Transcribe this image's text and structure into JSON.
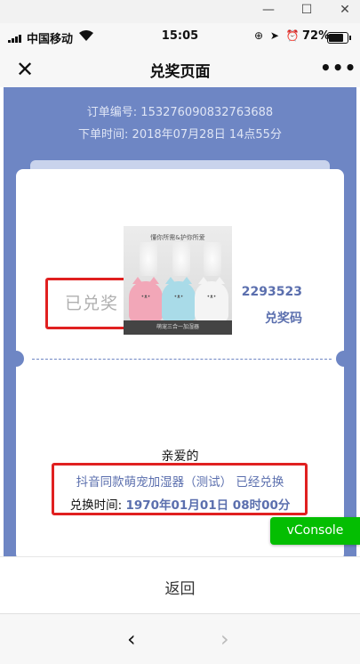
{
  "window": {
    "minimize": "—",
    "maximize": "☐",
    "close": "✕"
  },
  "status_bar": {
    "carrier": "中国移动",
    "time": "15:05",
    "icons": "⊕ ➤ ⏰",
    "battery_pct": "72%"
  },
  "nav": {
    "close_icon": "✕",
    "title": "兑奖页面",
    "more_icon": "•••"
  },
  "order": {
    "number_line": "订单编号: 153276090832763688",
    "time_line": "下单时间: 2018年07月28日 14点55分"
  },
  "ticket": {
    "status": "已兑奖",
    "code": "2293523",
    "code_label": "兑奖码"
  },
  "product_image": {
    "caption": "懂你所需&护你所爱",
    "base_text": "萌宠三合一加湿器"
  },
  "message": {
    "greeting": "亲爱的",
    "prize": "抖音同款萌宠加湿器（测试） 已经兑换",
    "redeem_time_label": "兑换时间: ",
    "redeem_time": "1970年01月01日 08时00分"
  },
  "vconsole": "vConsole",
  "back_label": "返回",
  "browser_nav": {
    "prev": "‹",
    "next": "›"
  },
  "colors": {
    "primary": "#6e86c4",
    "accent_text": "#5b6fae",
    "highlight_box": "#e02020",
    "vconsole": "#04be02"
  }
}
